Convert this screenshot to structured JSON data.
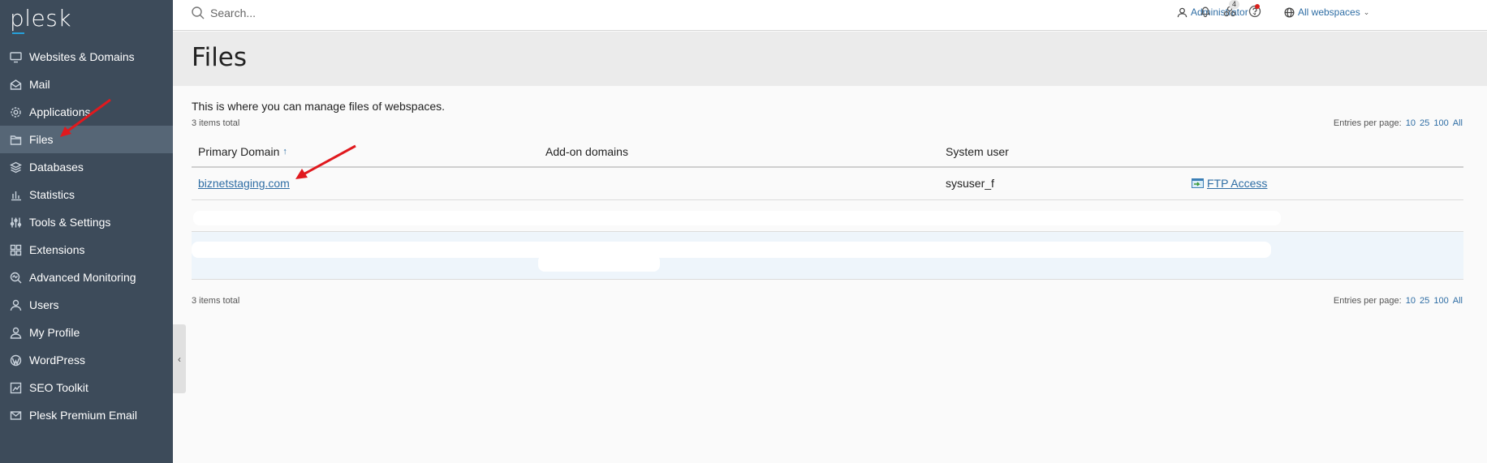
{
  "app": {
    "logo_text": "plesk"
  },
  "sidebar": {
    "items": [
      {
        "label": "Websites & Domains",
        "icon": "monitor-icon"
      },
      {
        "label": "Mail",
        "icon": "mail-icon"
      },
      {
        "label": "Applications",
        "icon": "gear-icon"
      },
      {
        "label": "Files",
        "icon": "folder-icon",
        "active": true
      },
      {
        "label": "Databases",
        "icon": "layers-icon"
      },
      {
        "label": "Statistics",
        "icon": "bar-chart-icon"
      },
      {
        "label": "Tools & Settings",
        "icon": "sliders-icon"
      },
      {
        "label": "Extensions",
        "icon": "grid-icon"
      },
      {
        "label": "Advanced Monitoring",
        "icon": "monitoring-icon"
      },
      {
        "label": "Users",
        "icon": "user-icon"
      },
      {
        "label": "My Profile",
        "icon": "profile-icon"
      },
      {
        "label": "WordPress",
        "icon": "wordpress-icon"
      },
      {
        "label": "SEO Toolkit",
        "icon": "seo-icon"
      },
      {
        "label": "Plesk Premium Email",
        "icon": "email-icon"
      }
    ]
  },
  "topbar": {
    "search_placeholder": "Search...",
    "user_label": "Administrator",
    "webspaces_label": "All webspaces",
    "notification_count": "4"
  },
  "page": {
    "title": "Files",
    "description": "This is where you can manage files of webspaces.",
    "items_total": "3 items total",
    "entries_per_page_label": "Entries per page:",
    "page_sizes": [
      "10",
      "25",
      "100",
      "All"
    ]
  },
  "table": {
    "columns": [
      "Primary Domain",
      "Add-on domains",
      "System user"
    ],
    "sort_indicator": "↑",
    "rows": [
      {
        "domain": "biznetstaging.com",
        "addon": "",
        "system_user": "sysuser_f",
        "action": "FTP Access"
      }
    ]
  },
  "colors": {
    "sidebar_bg": "#3d4b5a",
    "active_bg": "#566676",
    "link": "#2e6da4",
    "annotation": "#e0191e"
  }
}
